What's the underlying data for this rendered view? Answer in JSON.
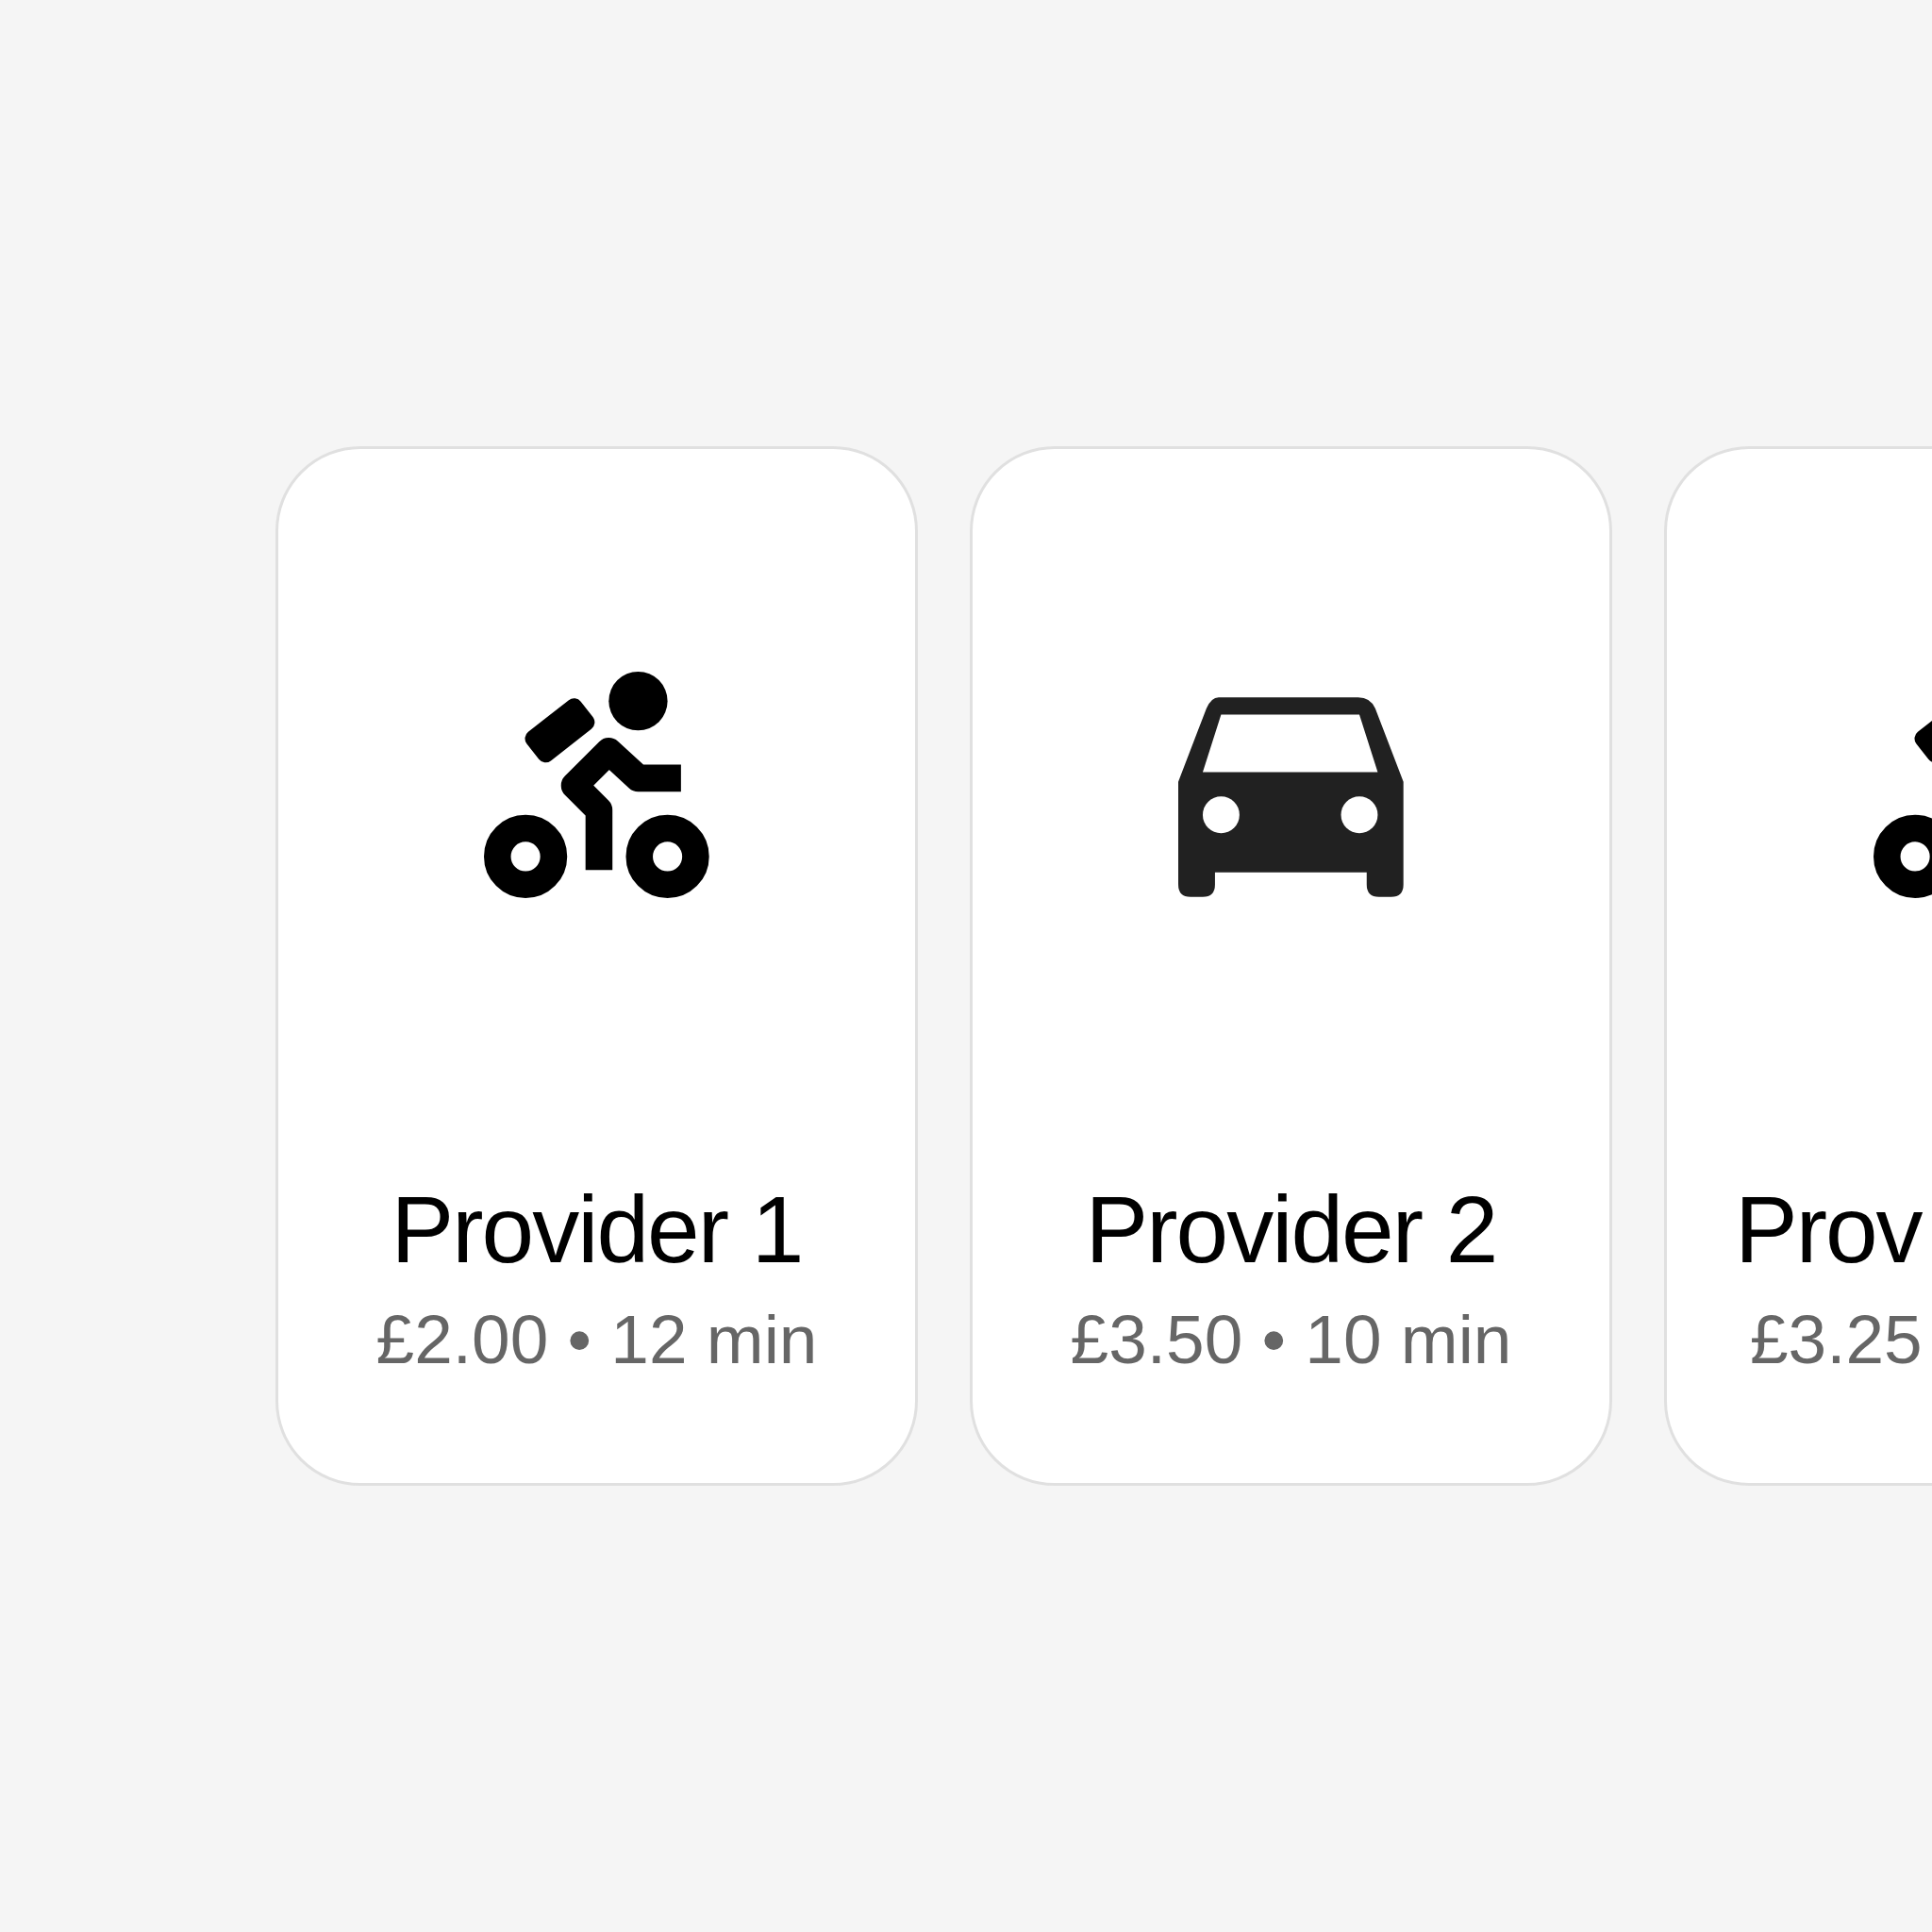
{
  "providers": [
    {
      "kind": "bike",
      "name": "Provider 1",
      "details": "£2.00 • 12 min",
      "cut": false
    },
    {
      "kind": "car",
      "name": "Provider 2",
      "details": "£3.50 • 10 min",
      "cut": false
    },
    {
      "kind": "bike",
      "name": "Prov",
      "details": "£3.25",
      "cut": true
    }
  ]
}
